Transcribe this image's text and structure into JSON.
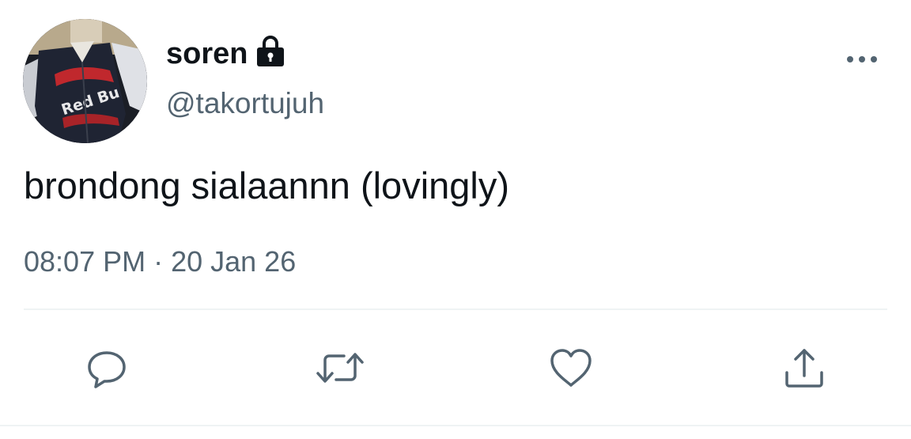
{
  "author": {
    "display_name": "soren",
    "handle": "@takortujuh",
    "protected": true,
    "avatar_jersey_text": "Red Bu"
  },
  "tweet": {
    "text": "brondong sialaannn (lovingly)",
    "time": "08:07 PM",
    "separator": "·",
    "date": "20 Jan 26"
  },
  "icons": {
    "lock": "lock-icon",
    "more": "more-horizontal-icon",
    "reply": "reply-icon",
    "retweet": "retweet-icon",
    "like": "heart-icon",
    "share": "share-icon"
  },
  "colors": {
    "text_primary": "#0f1419",
    "text_secondary": "#536471",
    "divider": "#eff3f4",
    "icon": "#536471"
  }
}
